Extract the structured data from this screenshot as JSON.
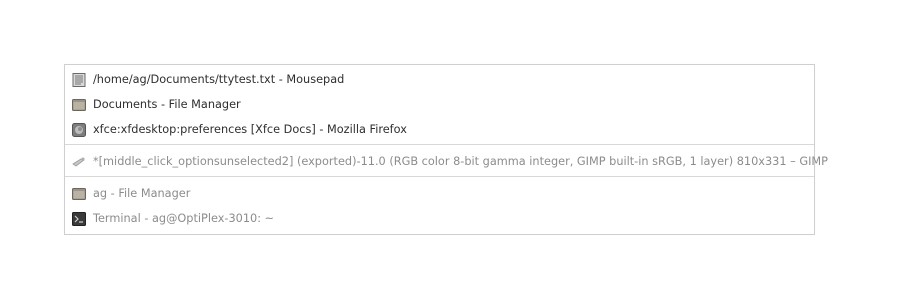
{
  "window_list": {
    "active_group": [
      {
        "label": "/home/ag/Documents/ttytest.txt - Mousepad",
        "icon": "text-editor-icon"
      },
      {
        "label": "Documents - File Manager",
        "icon": "folder-icon"
      },
      {
        "label": "xfce:xfdesktop:preferences [Xfce Docs] - Mozilla Firefox",
        "icon": "firefox-icon"
      }
    ],
    "minimized_group_1": [
      {
        "label": "*[middle_click_optionsunselected2] (exported)-11.0 (RGB color 8-bit gamma integer, GIMP built-in sRGB, 1 layer) 810x331 – GIMP",
        "icon": "gimp-icon"
      }
    ],
    "minimized_group_2": [
      {
        "label": "ag - File Manager",
        "icon": "folder-icon"
      },
      {
        "label": "Terminal - ag@OptiPlex-3010: ~",
        "icon": "terminal-icon"
      }
    ]
  },
  "colors": {
    "text": "#2e2e2e",
    "dim_text": "#8c8c8c",
    "border": "#cfcfcf"
  }
}
